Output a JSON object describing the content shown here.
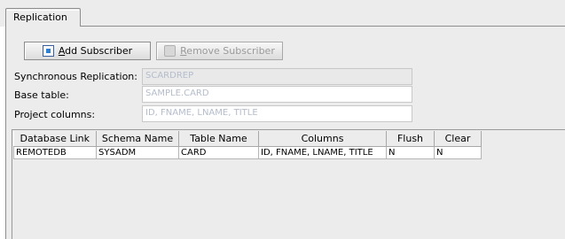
{
  "tab": {
    "label": "Replication"
  },
  "toolbar": {
    "add_subscriber": {
      "mnemonic": "A",
      "rest": "dd Subscriber",
      "icon": "add-subscriber-icon"
    },
    "remove_subscriber": {
      "mnemonic": "R",
      "rest": "emove Subscriber",
      "icon": "remove-subscriber-icon"
    }
  },
  "form": {
    "sync_replication": {
      "label": "Synchronous Replication:",
      "value": "SCARDREP"
    },
    "base_table": {
      "label": "Base table:",
      "value": "SAMPLE.CARD"
    },
    "project_columns": {
      "label": "Project columns:",
      "value": "ID, FNAME, LNAME, TITLE"
    }
  },
  "subscribers_table": {
    "headers": [
      "Database Link",
      "Schema Name",
      "Table Name",
      "Columns",
      "Flush",
      "Clear"
    ],
    "rows": [
      [
        "REMOTEDB",
        "SYSADM",
        "CARD",
        "ID, FNAME, LNAME, TITLE",
        "N",
        "N"
      ]
    ]
  }
}
